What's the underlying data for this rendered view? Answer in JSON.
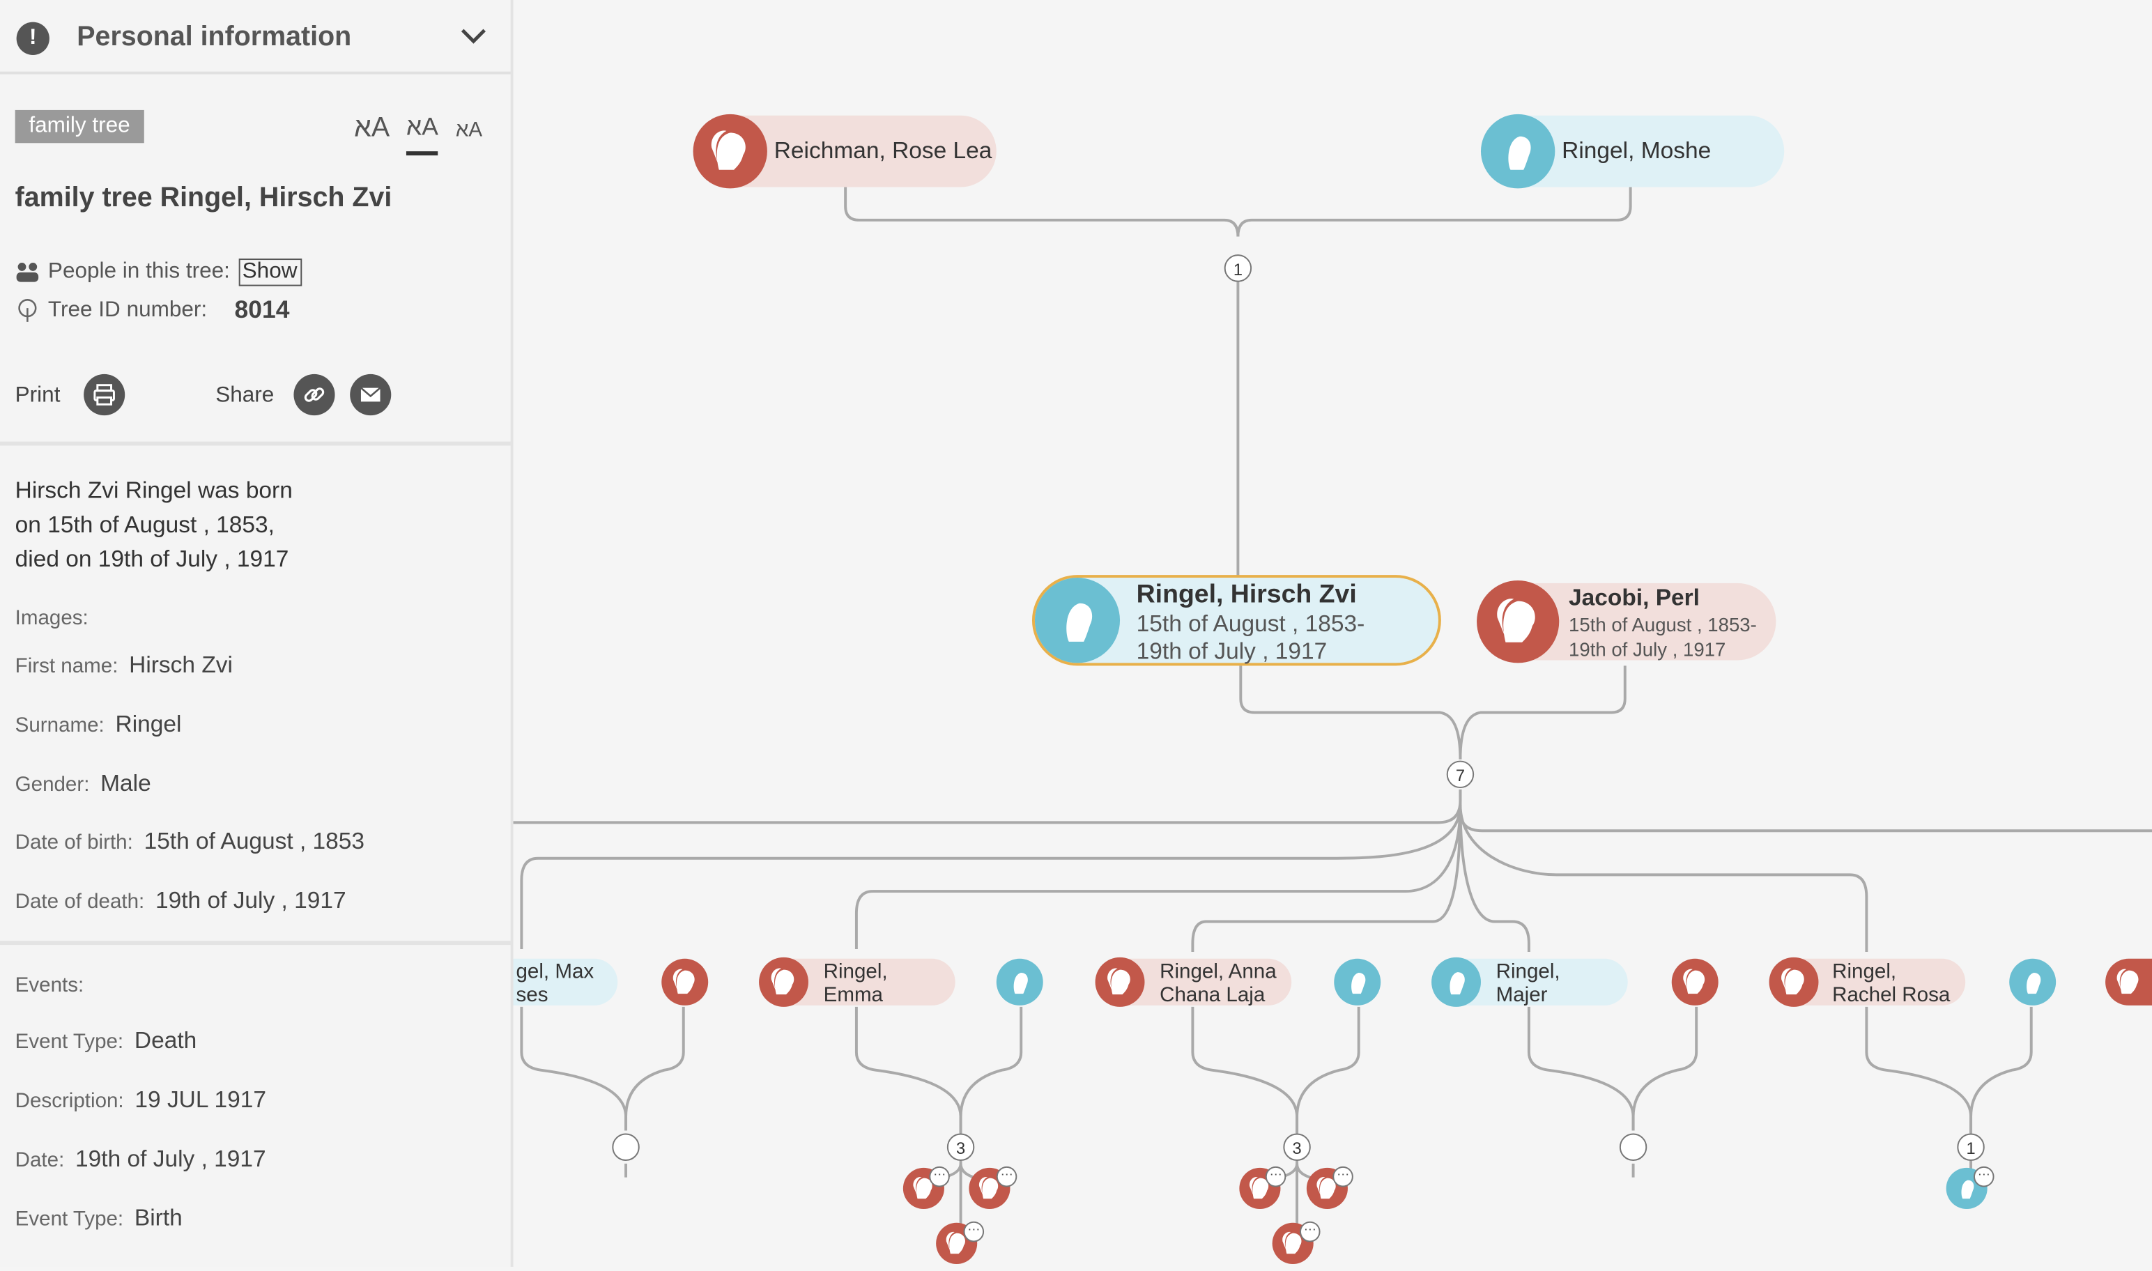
{
  "sidebar": {
    "header_title": "Personal information",
    "tag": "family tree",
    "font_size_options": [
      "אA",
      "אA",
      "אA"
    ],
    "tree_title": "family tree Ringel, Hirsch Zvi",
    "people_label": "People in this tree:",
    "show_button": "Show",
    "tree_id_label": "Tree ID number:",
    "tree_id_value": "8014",
    "print_label": "Print",
    "share_label": "Share",
    "bio_line1": "Hirsch Zvi Ringel was born",
    "bio_line2": "on 15th of August , 1853,",
    "bio_line3": "died on 19th of July , 1917",
    "images_label": "Images:",
    "fields": {
      "first_name_label": "First name:",
      "first_name": "Hirsch Zvi",
      "surname_label": "Surname:",
      "surname": "Ringel",
      "gender_label": "Gender:",
      "gender": "Male",
      "dob_label": "Date of birth:",
      "dob": "15th of August , 1853",
      "dod_label": "Date of death:",
      "dod": "19th of July , 1917"
    },
    "events_label": "Events:",
    "events": {
      "type1_label": "Event Type:",
      "type1": "Death",
      "desc_label": "Description:",
      "desc": "19 JUL 1917",
      "date_label": "Date:",
      "date": "19th of July , 1917",
      "type2_label": "Event Type:",
      "type2": "Birth"
    }
  },
  "tree": {
    "parent_mother": "Reichman, Rose Lea",
    "parent_father": "Ringel, Moshe",
    "parents_children_count": "1",
    "focus_name": "Ringel, Hirsch Zvi",
    "focus_dates_line1": "15th of August , 1853-",
    "focus_dates_line2": "19th of July , 1917",
    "spouse_name": "Jacobi, Perl",
    "spouse_dates_line1": "15th of August , 1853-",
    "spouse_dates_line2": "19th of July , 1917",
    "couple_children_count": "7",
    "children": [
      {
        "line1": "gel, Max",
        "line2": "ses"
      },
      {
        "line1": "Ringel,",
        "line2": "Emma"
      },
      {
        "line1": "Ringel, Anna",
        "line2": "Chana Laja"
      },
      {
        "line1": "Ringel,",
        "line2": "Majer"
      },
      {
        "line1": "Ringel,",
        "line2": "Rachel Rosa"
      }
    ],
    "grandchildren_counts": [
      "3",
      "3",
      "1"
    ],
    "more_indicator": "⋯"
  },
  "colors": {
    "female": "#c2584a",
    "male": "#6bbfd2",
    "focus_border": "#e8b04a"
  },
  "icons": [
    "alert-icon",
    "chevron-down-icon",
    "people-icon",
    "tree-icon",
    "printer-icon",
    "link-icon",
    "mail-icon",
    "female-silhouette-icon",
    "male-silhouette-icon"
  ]
}
